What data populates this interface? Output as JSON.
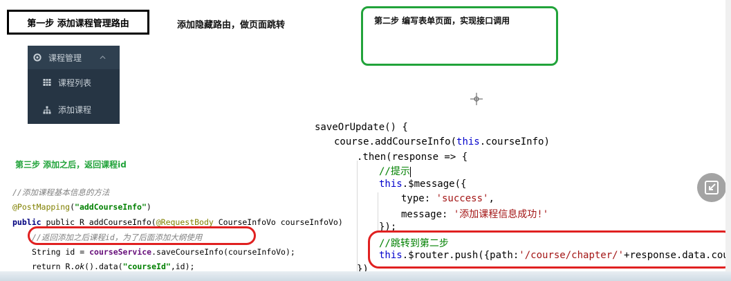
{
  "step1": {
    "label": "第一步 添加课程管理路由"
  },
  "hidden_route_note": "添加隐藏路由，做页面跳转",
  "step2": {
    "label": "第二步 编写表单页面，实现接口调用"
  },
  "menu": {
    "title": "课程管理",
    "items": [
      {
        "label": "课程列表",
        "icon": "table-icon"
      },
      {
        "label": "添加课程",
        "icon": "sitemap-icon"
      }
    ]
  },
  "step3": {
    "label": "第三步 添加之后，返回课程id"
  },
  "java_code": {
    "line1": "//添加课程基本信息的方法",
    "line2_ann": "@PostMapping",
    "line2_arg": "\"addCourseInfo\"",
    "line3_pre": "public R addCourseInfo(",
    "line3_ann": "@RequestBody",
    "line3_post": " CourseInfoVo courseInfoVo)",
    "line4": "//返回添加之后课程id，为了后面添加大纲使用",
    "line5_pre": "String id = ",
    "line5_field": "courseService",
    "line5_post": ".saveCourseInfo(courseInfoVo);",
    "line6_pre": "return R.",
    "line6_method": "ok",
    "line6_mid": "().data(",
    "line6_str": "\"courseId\"",
    "line6_post": ",id);"
  },
  "js_code": {
    "l1": "saveOrUpdate() {",
    "l2_pre": "course.addCourseInfo(",
    "l2_kw": "this",
    "l2_post": ".courseInfo)",
    "l3_pre": ".then(response => {",
    "l4": "//提示",
    "l5_kw": "this",
    "l5_post": ".$message({",
    "l6_pre": "type: ",
    "l6_str": "'success'",
    "l6_post": ",",
    "l7_pre": "message: ",
    "l7_str": "'添加课程信息成功!'",
    "l8": "});",
    "l9": "//跳转到第二步",
    "l10_kw": "this",
    "l10_mid": ".$router.push({path:",
    "l10_str": "'/course/chapter/'",
    "l10_post": "+response.data.courseI",
    "l11": "})"
  }
}
